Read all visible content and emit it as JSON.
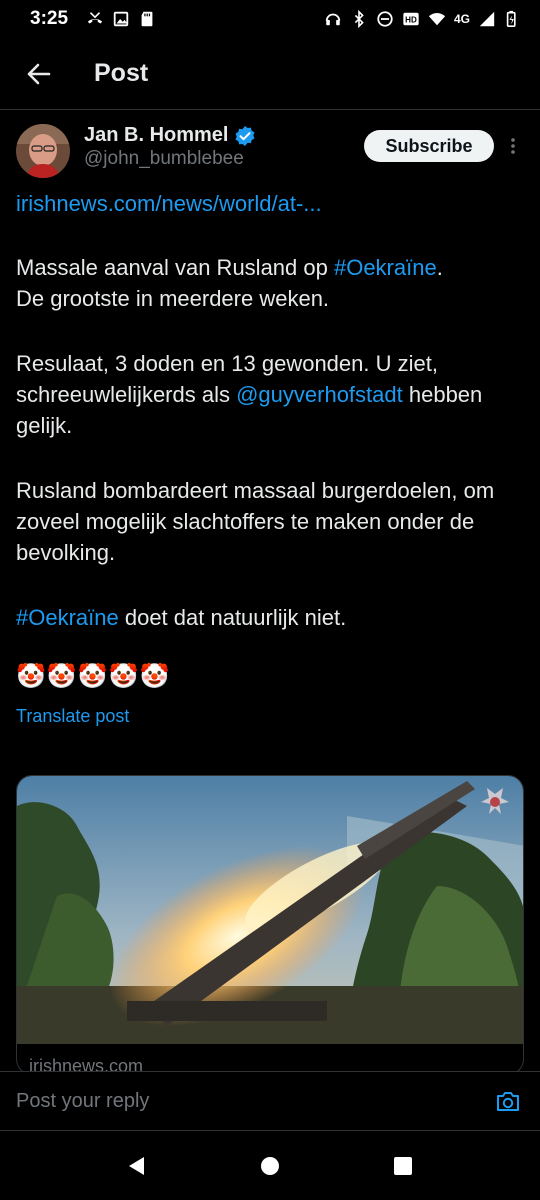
{
  "status_bar": {
    "time": "3:25",
    "network": "4G"
  },
  "header": {
    "title": "Post"
  },
  "post": {
    "author_name": "Jan B. Hommel",
    "author_handle": "@john_bumblebee",
    "subscribe_label": "Subscribe",
    "link_text": "irishnews.com/news/world/at-...",
    "para1_text": "Massale aanval van Rusland op ",
    "para1_hashtag": "#Oekraïne",
    "para1_text_end": ".",
    "para1_line2": "De grootste in meerdere weken.",
    "para2_text": "Resulaat, 3 doden en 13 gewonden. U ziet, schreeuwlelijkerds als ",
    "para2_mention": "@guyverhofstadt",
    "para2_text_end": " hebben gelijk.",
    "para3_text": "Rusland bombardeert massaal burgerdoelen, om zoveel mogelijk slachtoffers te maken onder de bevolking.",
    "para4_hashtag": "#Oekraïne",
    "para4_text": " doet dat natuurlijk niet.",
    "emojis": "🤡🤡🤡🤡🤡",
    "translate_label": "Translate post"
  },
  "card": {
    "domain": "irishnews.com"
  },
  "reply": {
    "placeholder": "Post your reply"
  },
  "colors": {
    "accent": "#1d9bf0",
    "background": "#000000",
    "text": "#e7e9ea",
    "muted": "#71767b",
    "verified": "#1d9bf0"
  }
}
